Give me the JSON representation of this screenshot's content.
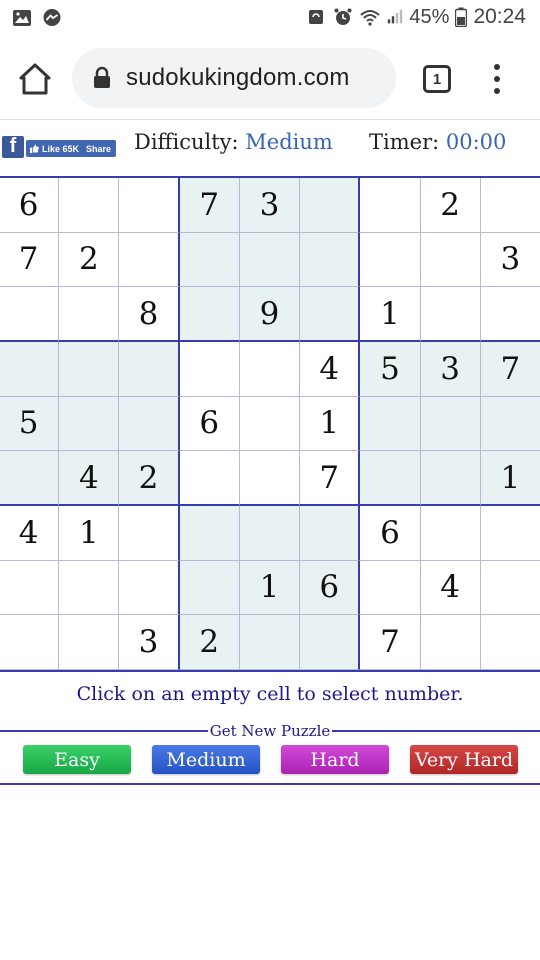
{
  "status": {
    "battery": "45%",
    "time": "20:24",
    "left_icons": [
      "gallery-icon",
      "messenger-icon"
    ],
    "right_icons": [
      "sync-icon",
      "alarm-icon",
      "wifi-icon",
      "signal-icon",
      "battery-icon"
    ]
  },
  "browser": {
    "url": "sudokukingdom.com",
    "tab_count": "1"
  },
  "social": {
    "fb_logo": "f",
    "like_label": "Like 65K",
    "share_label": "Share"
  },
  "info": {
    "difficulty_label": "Difficulty:",
    "difficulty_value": "Medium",
    "timer_label": "Timer:",
    "timer_value": "00:00"
  },
  "grid": {
    "rows": [
      [
        "6",
        "",
        "",
        "7",
        "3",
        "",
        "",
        "2",
        ""
      ],
      [
        "7",
        "2",
        "",
        "",
        "",
        "",
        "",
        "",
        "3"
      ],
      [
        "",
        "",
        "8",
        "",
        "9",
        "",
        "1",
        "",
        ""
      ],
      [
        "",
        "",
        "",
        "",
        "",
        "4",
        "5",
        "3",
        "7"
      ],
      [
        "5",
        "",
        "",
        "6",
        "",
        "1",
        "",
        "",
        ""
      ],
      [
        "",
        "4",
        "2",
        "",
        "",
        "7",
        "",
        "",
        "1"
      ],
      [
        "4",
        "1",
        "",
        "",
        "",
        "",
        "6",
        "",
        ""
      ],
      [
        "",
        "",
        "",
        "",
        "1",
        "6",
        "",
        "4",
        ""
      ],
      [
        "",
        "",
        "3",
        "2",
        "",
        "",
        "7",
        "",
        ""
      ]
    ]
  },
  "hint": "Click on an empty cell to select number.",
  "new_puzzle": {
    "legend": "Get New Puzzle",
    "buttons": {
      "easy": "Easy",
      "medium": "Medium",
      "hard": "Hard",
      "very_hard": "Very Hard"
    }
  },
  "colors": {
    "accent_blue": "#3a64b5",
    "grid_line": "#3b3bb0",
    "shade": "#e8f2f2"
  }
}
